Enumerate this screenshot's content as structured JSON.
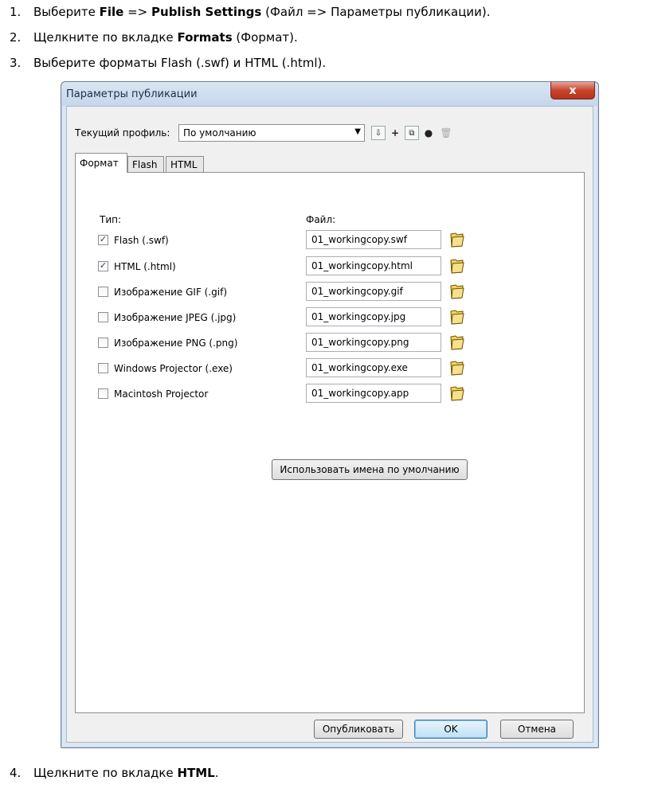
{
  "instructions": {
    "step1": {
      "num": "1.",
      "pre": "Выберите ",
      "b1": "File",
      "mid": " => ",
      "b2": "Publish Settings",
      "post": " (Файл => Параметры публикации)."
    },
    "step2": {
      "num": "2.",
      "pre": "Щелкните по вкладке ",
      "b1": "Formats",
      "post": " (Формат)."
    },
    "step3": {
      "num": "3.",
      "text": "Выберите форматы Flash (.swf) и HTML (.html)."
    },
    "step4": {
      "num": "4.",
      "pre": "Щелкните по вкладке ",
      "b1": "HTML",
      "post": "."
    }
  },
  "dialog": {
    "title": "Параметры публикации",
    "close_label": "x",
    "profile_label": "Текущий профиль:",
    "profile_value": "По умолчанию",
    "tabs": [
      {
        "label": "Формат"
      },
      {
        "label": "Flash"
      },
      {
        "label": "HTML"
      }
    ],
    "type_header": "Тип:",
    "file_header": "Файл:",
    "formats": [
      {
        "label": "Flash  (.swf)",
        "checked": true,
        "file": "01_workingcopy.swf"
      },
      {
        "label": "HTML (.html)",
        "checked": true,
        "file": "01_workingcopy.html"
      },
      {
        "label": "Изображение GIF (.gif)",
        "checked": false,
        "file": "01_workingcopy.gif"
      },
      {
        "label": "Изображение JPEG (.jpg)",
        "checked": false,
        "file": "01_workingcopy.jpg"
      },
      {
        "label": "Изображение PNG (.png)",
        "checked": false,
        "file": "01_workingcopy.png"
      },
      {
        "label": "Windows Projector (.exe)",
        "checked": false,
        "file": "01_workingcopy.exe"
      },
      {
        "label": "Macintosh Projector",
        "checked": false,
        "file": "01_workingcopy.app"
      }
    ],
    "default_names_label": "Использовать имена по умолчанию",
    "publish_label": "Опубликовать",
    "ok_label": "OK",
    "cancel_label": "Отмена",
    "check_mark": "✓"
  }
}
